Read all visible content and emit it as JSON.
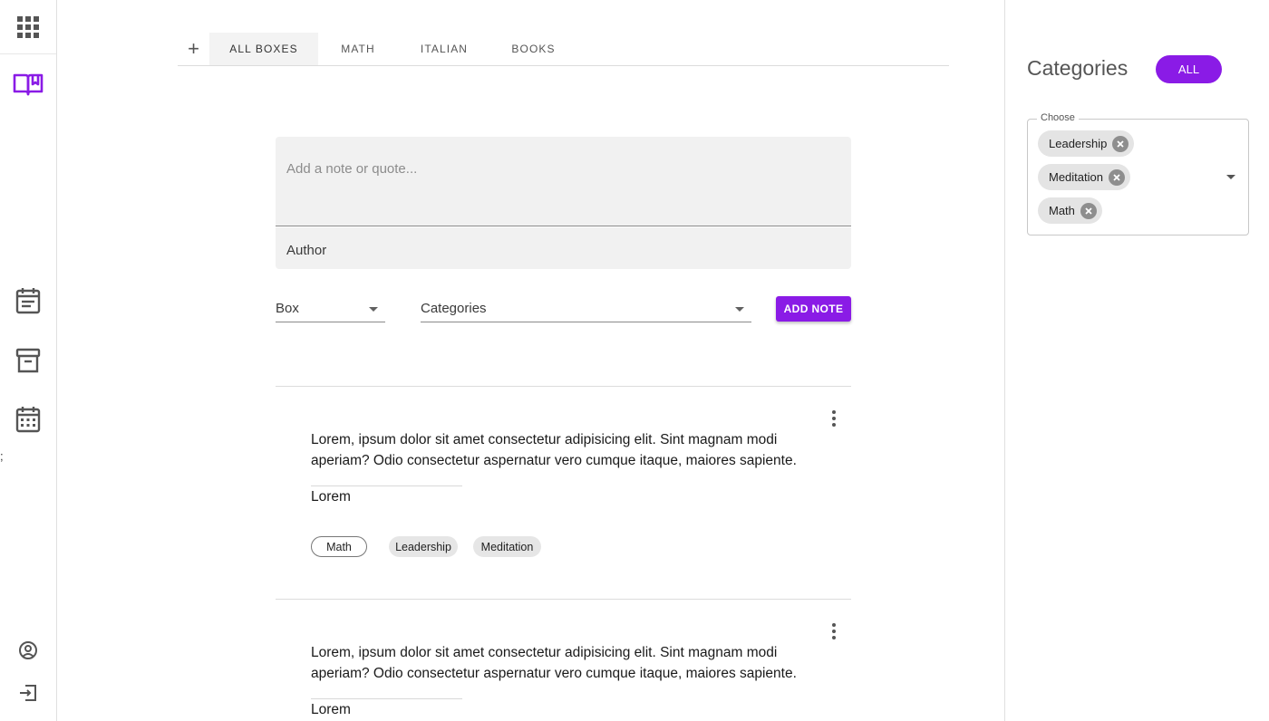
{
  "sidebar": {
    "icons": [
      "apps-grid-icon",
      "book-open-icon",
      "calendar-note-icon",
      "archive-box-icon",
      "calendar-grid-icon",
      "account-circle-icon",
      "logout-icon"
    ],
    "stray_char": ";",
    "accent_color": "#8a1be6"
  },
  "tabs": {
    "add_label": "+",
    "items": [
      {
        "label": "ALL BOXES",
        "active": true
      },
      {
        "label": "MATH",
        "active": false
      },
      {
        "label": "ITALIAN",
        "active": false
      },
      {
        "label": "BOOKS",
        "active": false
      }
    ]
  },
  "form": {
    "note_placeholder": "Add a note or quote...",
    "author_label": "Author",
    "box_label": "Box",
    "categories_label": "Categories",
    "add_button": "ADD NOTE"
  },
  "notes": [
    {
      "text": "Lorem, ipsum dolor sit amet consectetur adipisicing elit. Sint magnam modi aperiam? Odio consectetur aspernatur vero cumque itaque, maiores sapiente.",
      "author": "Lorem",
      "tags": [
        "Math",
        "Leadership",
        "Meditation"
      ]
    },
    {
      "text": "Lorem, ipsum dolor sit amet consectetur adipisicing elit. Sint magnam modi aperiam? Odio consectetur aspernatur vero cumque itaque, maiores sapiente.",
      "author": "Lorem",
      "tags": []
    }
  ],
  "categories_panel": {
    "title": "Categories",
    "all_button": "ALL",
    "choose_label": "Choose",
    "selected": [
      "Leadership",
      "Meditation",
      "Math"
    ]
  },
  "colors": {
    "accent": "#8a1be6",
    "field_bg": "#f1f1f1",
    "chip_bg": "#e6e6e6"
  }
}
